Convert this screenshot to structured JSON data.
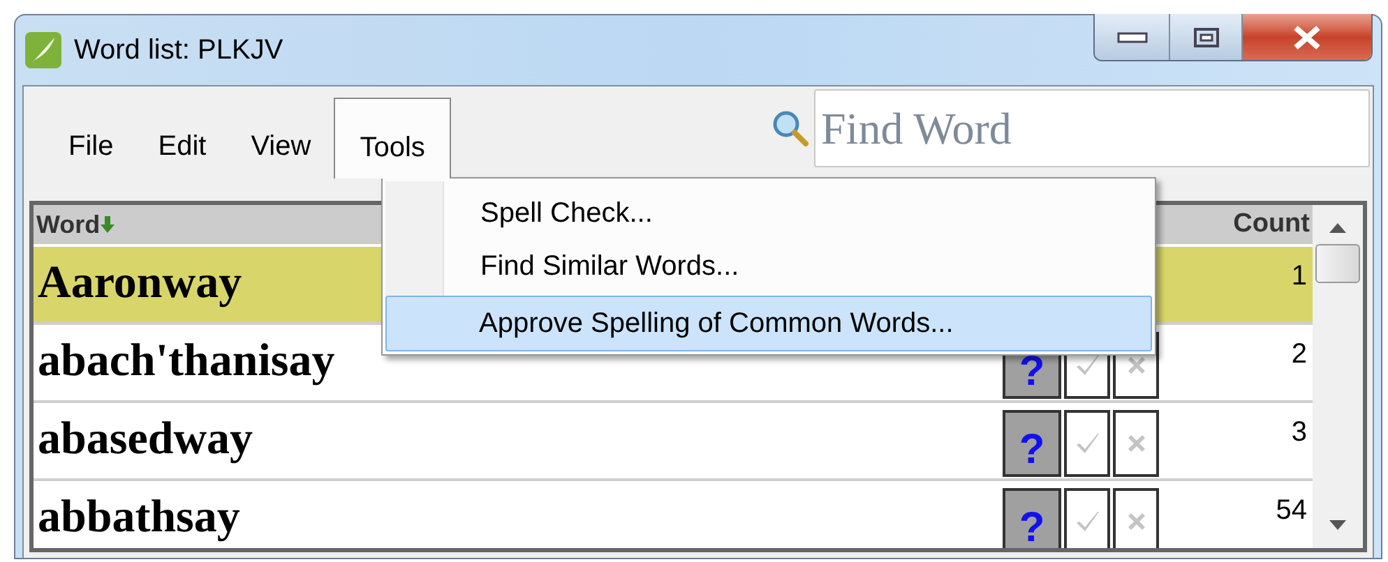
{
  "window": {
    "title": "Word list: PLKJV"
  },
  "menu": [
    {
      "label": "File",
      "selected": false
    },
    {
      "label": "Edit",
      "selected": false
    },
    {
      "label": "View",
      "selected": false
    },
    {
      "label": "Tools",
      "selected": true
    }
  ],
  "search": {
    "placeholder": "Find Word"
  },
  "dropdown": [
    {
      "label": "Spell Check...",
      "selected": false
    },
    {
      "label": "Find Similar Words...",
      "selected": false
    },
    {
      "label": "Approve Spelling of Common Words...",
      "selected": true
    }
  ],
  "table": {
    "columns": [
      "Word",
      "Count"
    ],
    "rows": [
      {
        "word": "Aaronway",
        "count": "1",
        "selected": true
      },
      {
        "word": "abach'thanisay",
        "count": "2",
        "selected": false,
        "flag": "?"
      },
      {
        "word": "abasedway",
        "count": "3",
        "selected": false,
        "flag": "?"
      },
      {
        "word": "abbathsay",
        "count": "54",
        "selected": false,
        "flag": "?"
      }
    ]
  }
}
